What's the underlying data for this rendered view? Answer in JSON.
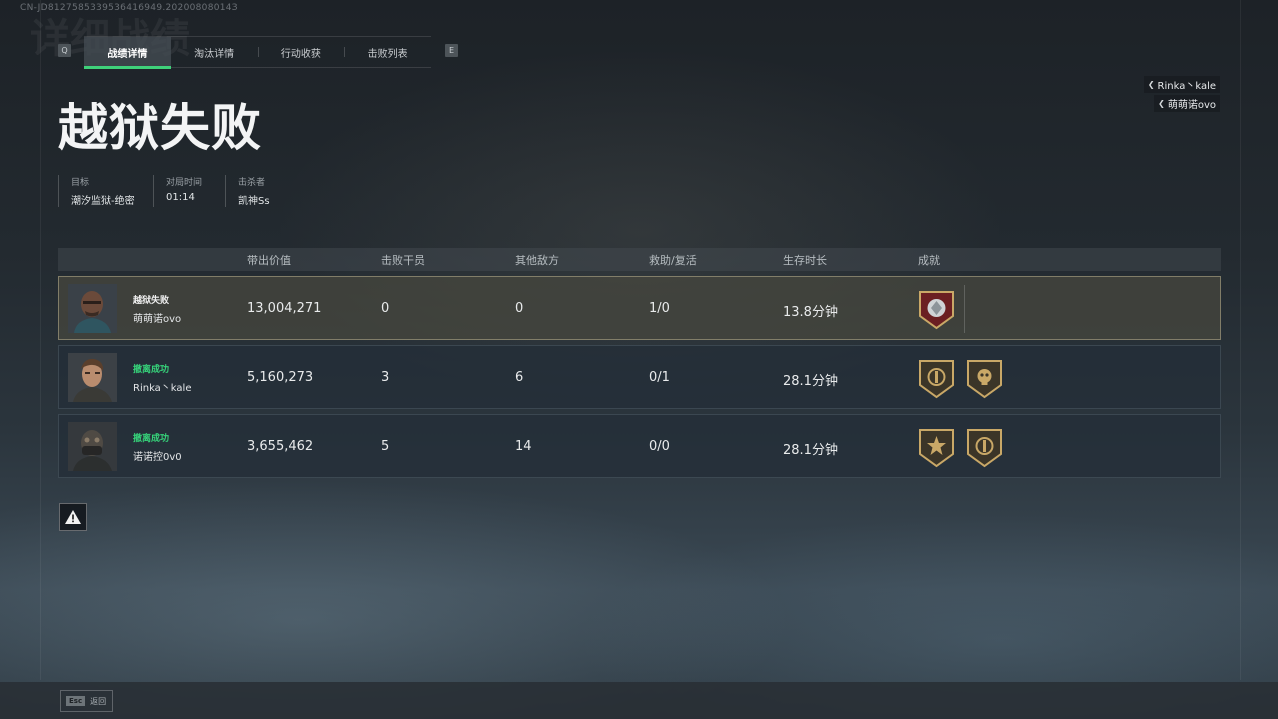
{
  "build_id": "CN-JD8127585339536416949.20200808014З",
  "ghost_title": "详细战绩",
  "tabs": {
    "prev_key": "Q",
    "next_key": "E",
    "items": [
      "战绩详情",
      "淘汰详情",
      "行动收获",
      "击败列表"
    ],
    "active_index": 0
  },
  "squad": [
    "Rinka丶kale",
    "萌萌诺ovo"
  ],
  "title": "越狱失败",
  "meta": {
    "target_label": "目标",
    "target_value": "潮汐监狱-绝密",
    "time_label": "对局时间",
    "time_value": "01:14",
    "killer_label": "击杀者",
    "killer_value": "凯神Ss"
  },
  "table": {
    "headers": [
      "带出价值",
      "击败干员",
      "其他敌方",
      "救助/复活",
      "生存时长",
      "成就"
    ],
    "rows": [
      {
        "status": "越狱失败",
        "status_type": "fail",
        "name": "萌萌诺ovo",
        "value": "13,004,271",
        "kills": "0",
        "others": "0",
        "assist": "1/0",
        "survival": "13.8分钟",
        "badges": [
          "red-gem-badge"
        ]
      },
      {
        "status": "撤离成功",
        "status_type": "success",
        "name": "Rinka丶kale",
        "value": "5,160,273",
        "kills": "3",
        "others": "6",
        "assist": "0/1",
        "survival": "28.1分钟",
        "badges": [
          "gold-crest-badge",
          "gold-skull-badge"
        ]
      },
      {
        "status": "撤离成功",
        "status_type": "success",
        "name": "诺诺控0v0",
        "value": "3,655,462",
        "kills": "5",
        "others": "14",
        "assist": "0/0",
        "survival": "28.1分钟",
        "badges": [
          "gold-star-badge",
          "gold-crest-badge"
        ]
      }
    ]
  },
  "footer": {
    "esc_key": "Esc",
    "esc_label": "返回"
  },
  "colors": {
    "accent_green": "#3fd17a",
    "success_text": "#36d37a",
    "badge_gold": "#c9a867",
    "badge_red": "#8a2a2a"
  }
}
